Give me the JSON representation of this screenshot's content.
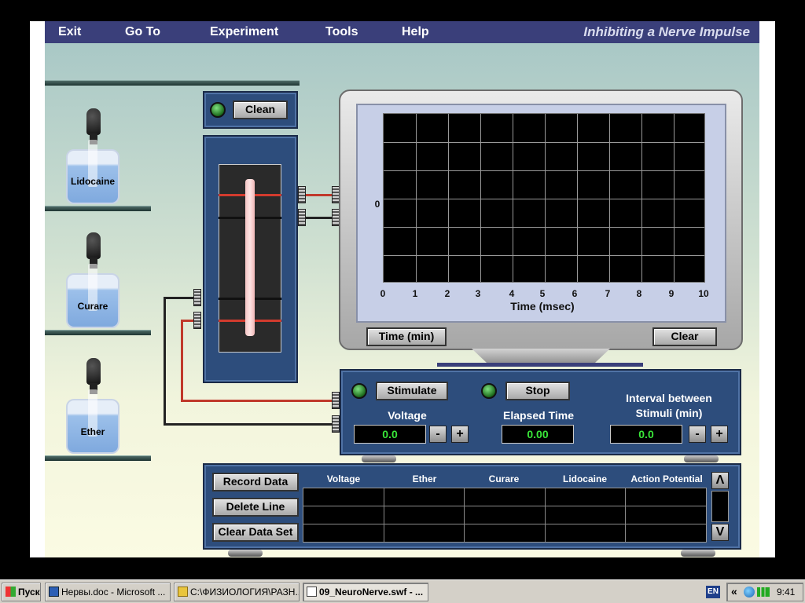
{
  "menu": {
    "items": [
      "Exit",
      "Go To",
      "Experiment",
      "Tools",
      "Help"
    ],
    "title": "Inhibiting a Nerve Impulse"
  },
  "bottles": [
    "Lidocaine",
    "Curare",
    "Ether"
  ],
  "nerve_chamber": {
    "clean_label": "Clean"
  },
  "oscilloscope": {
    "y_zero_label": "0",
    "x_ticks": [
      "0",
      "1",
      "2",
      "3",
      "4",
      "5",
      "6",
      "7",
      "8",
      "9",
      "10"
    ],
    "x_axis_label": "Time (msec)",
    "time_button": "Time (min)",
    "clear_button": "Clear"
  },
  "stimulator": {
    "stimulate_label": "Stimulate",
    "stop_label": "Stop",
    "voltage_label": "Voltage",
    "voltage_value": "0.0",
    "elapsed_label": "Elapsed Time",
    "elapsed_value": "0.00",
    "interval_label": "Interval between Stimuli (min)",
    "interval_value": "0.0",
    "minus": "-",
    "plus": "+"
  },
  "data_table": {
    "buttons": [
      "Record Data",
      "Delete Line",
      "Clear Data Set"
    ],
    "columns": [
      "Voltage",
      "Ether",
      "Curare",
      "Lidocaine",
      "Action Potential"
    ],
    "scroll_up": "Λ",
    "scroll_down": "V"
  },
  "taskbar": {
    "start": "Пуск",
    "tasks": [
      "Нервы.doc - Microsoft ...",
      "C:\\ФИЗИОЛОГИЯ\\РАЗН...",
      "09_NeuroNerve.swf - ..."
    ],
    "lang": "EN",
    "tray_chevron": "«",
    "clock": "9:41"
  },
  "colors": {
    "menubar": "#3a3f7a",
    "panel": "#2d4d7c",
    "lcd_text": "#39e639",
    "stimulus_wire": "#c0392b"
  }
}
